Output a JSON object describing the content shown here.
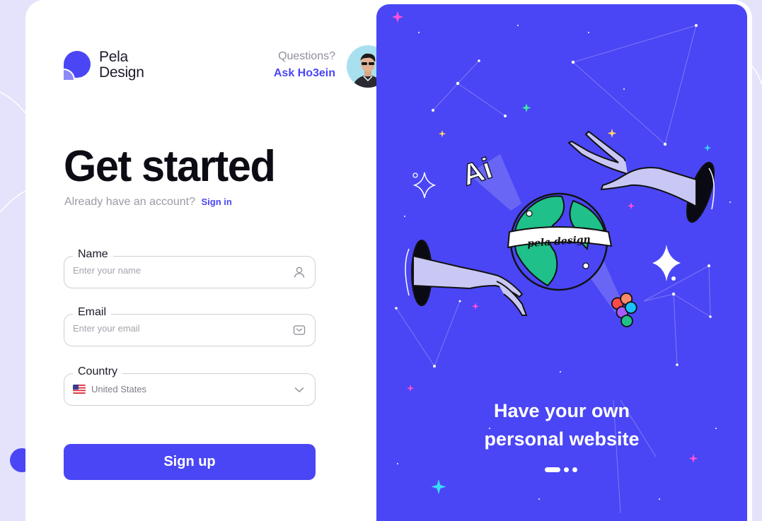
{
  "brand": {
    "line1": "Pela",
    "line2": "Design"
  },
  "help": {
    "question": "Questions?",
    "link": "Ask Ho3ein"
  },
  "heading": {
    "title": "Get started",
    "account_text": "Already have an account?",
    "signin_link": "Sign in"
  },
  "form": {
    "name": {
      "label": "Name",
      "placeholder": "Enter your name",
      "icon": "user-icon"
    },
    "email": {
      "label": "Email",
      "placeholder": "Enter your email",
      "icon": "mail-icon"
    },
    "country": {
      "label": "Country",
      "value": "United States",
      "icon": "chevron-down-icon"
    },
    "submit": "Sign up"
  },
  "illustration": {
    "badge_text": "pela design",
    "ai_text": "Ai"
  },
  "promo": {
    "line1": "Have your own",
    "line2": "personal website",
    "carousel": {
      "count": 3,
      "active": 1
    }
  },
  "colors": {
    "accent": "#4a46f5",
    "panel": "#4a46f5",
    "globe": "#1fc08a",
    "hand": "#c9c8f4"
  }
}
